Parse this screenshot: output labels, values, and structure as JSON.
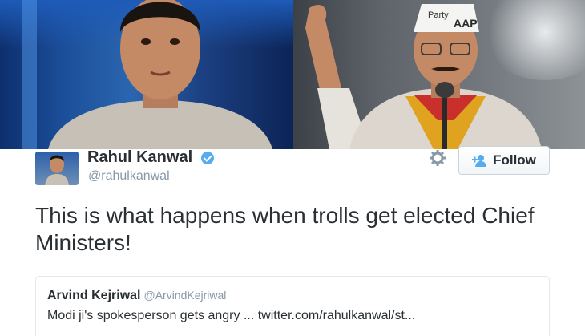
{
  "tweet": {
    "author_name": "Rahul Kanwal",
    "author_handle": "@rahulkanwal",
    "follow_label": "Follow",
    "text": "This is what happens when trolls get elected Chief Ministers!"
  },
  "quoted_tweet": {
    "author_name": "Arvind Kejriwal",
    "author_handle": "@ArvindKejriwal",
    "text": "Modi ji's spokesperson gets angry ... twitter.com/rahulkanwal/st..."
  },
  "photos": {
    "right_cap_text": "AAP",
    "right_cap_small": "Party"
  },
  "colors": {
    "verified": "#55acee",
    "text": "#292f33",
    "muted": "#8899a6"
  },
  "icons": [
    "verified-badge-icon",
    "settings-icon",
    "follow-user-icon"
  ]
}
